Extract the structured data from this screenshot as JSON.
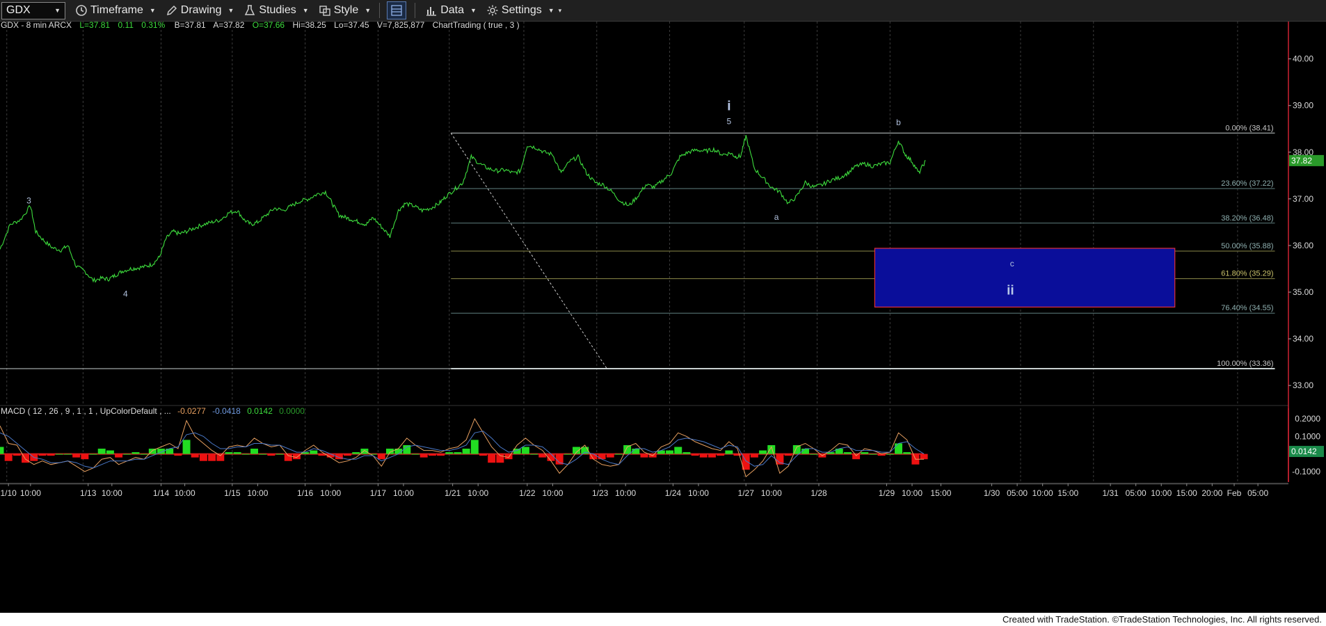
{
  "toolbar": {
    "symbol": "GDX",
    "items": [
      {
        "label": "Timeframe",
        "icon": "clock-icon"
      },
      {
        "label": "Drawing",
        "icon": "pencil-icon"
      },
      {
        "label": "Studies",
        "icon": "flask-icon"
      },
      {
        "label": "Style",
        "icon": "style-icon"
      },
      {
        "label": "Data",
        "icon": "bar-chart-icon"
      },
      {
        "label": "Settings",
        "icon": "gear-icon"
      }
    ]
  },
  "header": {
    "symbol_desc": "GDX - 8 min  ARCX",
    "last": "L=37.81",
    "change": "0.11",
    "change_pct": "0.31%",
    "bid": "B=37.81",
    "ask": "A=37.82",
    "open": "O=37.66",
    "high": "Hi=38.25",
    "low": "Lo=37.45",
    "volume": "V=7,825,877",
    "study": "ChartTrading ( true , 3 )"
  },
  "macd_header": {
    "label": "MACD ( 12 , 26 , 9 , 1 , 1 , UpColorDefault , ...",
    "v1": "-0.0277",
    "v2": "-0.0418",
    "v3": "0.0142",
    "v4": "0.0000"
  },
  "footer": "Created with TradeStation. ©TradeStation Technologies, Inc. All rights reserved.",
  "colors": {
    "price": "#3ddc3d",
    "fib": "#7d9b9b",
    "box_fill": "#0a0e9a",
    "box_border": "#e0303a",
    "macd_pos": "#22dd22",
    "macd_neg": "#ee1111",
    "macd_line": "#e8a060",
    "signal_line": "#4a78c8",
    "macd_zero": "#cc2222",
    "last_price_tag": "#2a9a2a",
    "macd_tag": "#1a8a4a"
  },
  "chart_data": {
    "type": "line",
    "title": "",
    "xlabel": "",
    "ylabel": "",
    "ylim": [
      32.6,
      40.8
    ],
    "price_axis_ticks": [
      "40.00",
      "39.00",
      "38.00",
      "37.00",
      "36.00",
      "35.00",
      "34.00",
      "33.00"
    ],
    "last_price_tag": "37.82",
    "time_ticks": [
      {
        "t": 0.5,
        "label": "1/10"
      },
      {
        "t": 1.8,
        "label": "10:00"
      },
      {
        "t": 5.2,
        "label": "1/13"
      },
      {
        "t": 6.6,
        "label": "10:00"
      },
      {
        "t": 9.5,
        "label": "1/14"
      },
      {
        "t": 10.9,
        "label": "10:00"
      },
      {
        "t": 13.7,
        "label": "1/15"
      },
      {
        "t": 15.2,
        "label": "10:00"
      },
      {
        "t": 18.0,
        "label": "1/16"
      },
      {
        "t": 19.5,
        "label": "10:00"
      },
      {
        "t": 22.3,
        "label": "1/17"
      },
      {
        "t": 23.8,
        "label": "10:00"
      },
      {
        "t": 26.7,
        "label": "1/21"
      },
      {
        "t": 28.2,
        "label": "10:00"
      },
      {
        "t": 31.1,
        "label": "1/22"
      },
      {
        "t": 32.6,
        "label": "10:00"
      },
      {
        "t": 35.4,
        "label": "1/23"
      },
      {
        "t": 36.9,
        "label": "10:00"
      },
      {
        "t": 39.7,
        "label": "1/24"
      },
      {
        "t": 41.2,
        "label": "10:00"
      },
      {
        "t": 44.0,
        "label": "1/27"
      },
      {
        "t": 45.5,
        "label": "10:00"
      },
      {
        "t": 48.3,
        "label": "1/28"
      },
      {
        "t": 52.3,
        "label": "1/29"
      },
      {
        "t": 53.8,
        "label": "10:00"
      },
      {
        "t": 55.5,
        "label": "15:00"
      },
      {
        "t": 58.5,
        "label": "1/30"
      },
      {
        "t": 60.0,
        "label": "05:00"
      },
      {
        "t": 61.5,
        "label": "10:00"
      },
      {
        "t": 63.0,
        "label": "15:00"
      },
      {
        "t": 65.5,
        "label": "1/31"
      },
      {
        "t": 67.0,
        "label": "05:00"
      },
      {
        "t": 68.5,
        "label": "10:00"
      },
      {
        "t": 70.0,
        "label": "15:00"
      },
      {
        "t": 71.5,
        "label": "20:00"
      },
      {
        "t": 72.8,
        "label": "Feb"
      },
      {
        "t": 74.2,
        "label": "05:00"
      }
    ],
    "t_range": [
      0,
      76
    ],
    "session_separators": [
      0.4,
      4.9,
      9.5,
      13.7,
      18.0,
      22.3,
      26.5,
      30.9,
      35.2,
      39.5,
      43.9,
      48.2,
      52.5,
      60.2,
      64.5,
      73.0
    ],
    "series": [
      {
        "x": [
          0,
          0.6,
          1.2,
          1.8,
          2.1,
          2.6,
          3.1,
          3.6,
          4.0,
          4.5,
          5.0,
          5.5,
          6.0,
          6.4,
          6.8,
          7.2,
          7.7,
          8.1,
          8.6,
          9.0,
          9.4,
          9.8,
          10.2,
          10.6,
          11.0,
          11.5,
          12.0,
          12.5,
          13.0,
          13.5,
          14.0,
          14.4,
          14.8,
          15.2,
          15.7,
          16.2,
          16.7,
          17.2,
          17.7,
          18.2,
          18.7,
          19.2,
          19.6,
          20.0,
          20.4,
          20.8,
          21.2,
          21.6,
          22.0,
          22.5,
          23.0,
          23.5,
          23.9,
          24.4,
          24.9,
          25.4,
          25.9,
          26.3,
          26.8,
          27.3,
          27.8,
          28.3,
          28.8,
          29.3,
          29.8,
          30.3,
          30.7,
          31.1,
          31.6,
          32.1,
          32.6,
          33.1,
          33.6,
          34.1,
          34.6,
          35.1,
          35.6,
          36.1,
          36.6,
          37.1,
          37.6,
          38.1,
          38.6,
          39.1,
          39.6,
          40.1,
          40.6,
          41.1,
          41.6,
          42.1,
          42.6,
          43.1,
          43.4,
          43.7,
          44.0,
          44.5,
          45.0,
          45.5,
          46.0,
          46.5,
          47.0,
          47.5,
          48.0,
          48.5,
          49.0,
          49.5,
          50.0,
          50.5,
          51.0,
          51.5,
          52.0,
          52.5,
          53.0,
          53.4,
          53.8,
          54.2,
          54.6
        ],
        "y": [
          35.92,
          36.45,
          36.55,
          36.85,
          36.3,
          36.1,
          35.95,
          35.9,
          36.0,
          35.55,
          35.45,
          35.25,
          35.3,
          35.28,
          35.36,
          35.45,
          35.5,
          35.52,
          35.55,
          35.6,
          35.75,
          36.15,
          36.3,
          36.25,
          36.3,
          36.38,
          36.45,
          36.5,
          36.55,
          36.7,
          36.75,
          36.55,
          36.45,
          36.5,
          36.65,
          36.8,
          36.75,
          36.85,
          36.95,
          37.0,
          37.1,
          37.15,
          36.9,
          36.65,
          36.6,
          36.55,
          36.5,
          36.45,
          36.6,
          36.4,
          36.2,
          36.75,
          36.9,
          36.85,
          36.75,
          36.8,
          36.9,
          37.05,
          37.2,
          37.35,
          37.9,
          37.75,
          37.65,
          37.6,
          37.62,
          37.55,
          37.6,
          38.15,
          38.1,
          38.0,
          37.95,
          37.55,
          37.8,
          37.9,
          37.55,
          37.35,
          37.3,
          37.15,
          36.95,
          36.85,
          37.05,
          37.3,
          37.25,
          37.4,
          37.55,
          37.9,
          38.0,
          38.05,
          38.02,
          38.06,
          37.95,
          37.98,
          37.9,
          37.92,
          38.35,
          37.65,
          37.45,
          37.25,
          37.15,
          36.9,
          37.05,
          37.35,
          37.25,
          37.3,
          37.4,
          37.45,
          37.55,
          37.7,
          37.75,
          37.7,
          37.75,
          37.78,
          38.25,
          37.95,
          37.8,
          37.55,
          37.82
        ]
      }
    ],
    "fib_levels": [
      {
        "label": "0.00% (38.41)",
        "value": 38.41
      },
      {
        "label": "23.60% (37.22)",
        "value": 37.22
      },
      {
        "label": "38.20% (36.48)",
        "value": 36.48
      },
      {
        "label": "50.00% (35.88)",
        "value": 35.88
      },
      {
        "label": "61.80% (35.29)",
        "value": 35.29
      },
      {
        "label": "76.40% (34.55)",
        "value": 34.55
      },
      {
        "label": "100.00% (33.36)",
        "value": 33.36
      }
    ],
    "fib_range_t": [
      26.6,
      75.2
    ],
    "hline": {
      "value": 33.36
    },
    "diagonal": {
      "t": [
        26.6,
        35.8
      ],
      "y": [
        38.41,
        33.36
      ]
    },
    "target_box": {
      "t": [
        51.6,
        69.3
      ],
      "y": [
        34.68,
        35.94
      ]
    },
    "wave_labels": [
      {
        "text": "3",
        "t": 1.7,
        "y": 36.9,
        "size": 12
      },
      {
        "text": "4",
        "t": 7.4,
        "y": 34.9,
        "size": 12
      },
      {
        "text": "i",
        "t": 43.0,
        "y": 38.9,
        "size": 19
      },
      {
        "text": "5",
        "t": 43.0,
        "y": 38.6,
        "size": 12
      },
      {
        "text": "a",
        "t": 45.8,
        "y": 36.55,
        "size": 12
      },
      {
        "text": "b",
        "t": 53.0,
        "y": 38.58,
        "size": 12
      },
      {
        "text": "c",
        "t": 59.7,
        "y": 35.55,
        "size": 12
      },
      {
        "text": "ii",
        "t": 59.6,
        "y": 34.95,
        "size": 19
      }
    ],
    "macd": {
      "ylim": [
        -0.16,
        0.26
      ],
      "ticks": [
        "0.2000",
        "0.1000",
        "-0.1000"
      ],
      "last_value_tag": "0.0142",
      "x": [
        0,
        0.5,
        1.0,
        1.5,
        2.0,
        2.5,
        3.0,
        3.5,
        4.0,
        4.5,
        5.0,
        5.5,
        6.0,
        6.5,
        7.0,
        7.5,
        8.0,
        8.5,
        9.0,
        9.5,
        10.0,
        10.5,
        11.0,
        11.5,
        12.0,
        12.5,
        13.0,
        13.5,
        14.0,
        14.5,
        15.0,
        15.5,
        16.0,
        16.5,
        17.0,
        17.5,
        18.0,
        18.5,
        19.0,
        19.5,
        20.0,
        20.5,
        21.0,
        21.5,
        22.0,
        22.5,
        23.0,
        23.5,
        24.0,
        24.5,
        25.0,
        25.5,
        26.0,
        26.5,
        27.0,
        27.5,
        28.0,
        28.5,
        29.0,
        29.5,
        30.0,
        30.5,
        31.0,
        31.5,
        32.0,
        32.5,
        33.0,
        33.5,
        34.0,
        34.5,
        35.0,
        35.5,
        36.0,
        36.5,
        37.0,
        37.5,
        38.0,
        38.5,
        39.0,
        39.5,
        40.0,
        40.5,
        41.0,
        41.5,
        42.0,
        42.5,
        43.0,
        43.5,
        44.0,
        44.5,
        45.0,
        45.5,
        46.0,
        46.5,
        47.0,
        47.5,
        48.0,
        48.5,
        49.0,
        49.5,
        50.0,
        50.5,
        51.0,
        51.5,
        52.0,
        52.5,
        53.0,
        53.5,
        54.0,
        54.5
      ],
      "line": [
        0.16,
        0.06,
        0.05,
        -0.03,
        -0.06,
        -0.04,
        -0.06,
        -0.05,
        -0.04,
        -0.07,
        -0.1,
        -0.08,
        -0.03,
        -0.02,
        -0.06,
        -0.04,
        -0.02,
        -0.03,
        0.02,
        0.04,
        0.06,
        0.03,
        0.19,
        0.1,
        0.06,
        0.02,
        -0.01,
        0.04,
        0.05,
        0.04,
        0.09,
        0.06,
        0.04,
        0.05,
        -0.01,
        -0.02,
        0.02,
        0.05,
        0.01,
        -0.02,
        -0.05,
        -0.04,
        -0.02,
        0.02,
        -0.01,
        -0.07,
        0.01,
        0.03,
        0.09,
        0.05,
        0.02,
        0.02,
        0.01,
        0.03,
        0.04,
        0.08,
        0.2,
        0.12,
        0.04,
        -0.01,
        -0.02,
        0.05,
        0.09,
        0.05,
        0.02,
        -0.04,
        -0.11,
        -0.06,
        0.01,
        0.05,
        -0.03,
        -0.06,
        -0.07,
        -0.06,
        0.04,
        0.06,
        0.01,
        -0.01,
        0.04,
        0.06,
        0.12,
        0.1,
        0.07,
        0.05,
        0.03,
        0.02,
        0.07,
        0.03,
        -0.13,
        -0.09,
        -0.04,
        0.04,
        -0.11,
        -0.07,
        0.04,
        0.06,
        0.03,
        -0.01,
        0.02,
        0.06,
        0.05,
        -0.01,
        0.03,
        0.02,
        0.0,
        0.01,
        0.12,
        0.08,
        -0.03,
        -0.03
      ],
      "signal": [
        0.12,
        0.1,
        0.06,
        0.02,
        -0.02,
        -0.03,
        -0.05,
        -0.05,
        -0.04,
        -0.05,
        -0.07,
        -0.08,
        -0.06,
        -0.04,
        -0.04,
        -0.04,
        -0.03,
        -0.03,
        -0.01,
        0.01,
        0.03,
        0.04,
        0.11,
        0.12,
        0.1,
        0.06,
        0.03,
        0.03,
        0.04,
        0.04,
        0.06,
        0.06,
        0.05,
        0.05,
        0.03,
        0.01,
        0.01,
        0.03,
        0.02,
        0.0,
        -0.02,
        -0.03,
        -0.03,
        -0.01,
        -0.01,
        -0.04,
        -0.02,
        0.0,
        0.04,
        0.05,
        0.04,
        0.03,
        0.02,
        0.02,
        0.03,
        0.05,
        0.12,
        0.13,
        0.09,
        0.04,
        0.01,
        0.02,
        0.05,
        0.05,
        0.04,
        0.0,
        -0.05,
        -0.06,
        -0.03,
        0.01,
        0.0,
        -0.03,
        -0.05,
        -0.06,
        -0.01,
        0.03,
        0.03,
        0.01,
        0.02,
        0.04,
        0.08,
        0.09,
        0.08,
        0.07,
        0.05,
        0.03,
        0.05,
        0.04,
        -0.04,
        -0.07,
        -0.06,
        -0.01,
        -0.05,
        -0.06,
        -0.01,
        0.03,
        0.03,
        0.01,
        0.01,
        0.03,
        0.04,
        0.02,
        0.02,
        0.02,
        0.01,
        0.01,
        0.06,
        0.07,
        0.03,
        0.0
      ]
    }
  }
}
